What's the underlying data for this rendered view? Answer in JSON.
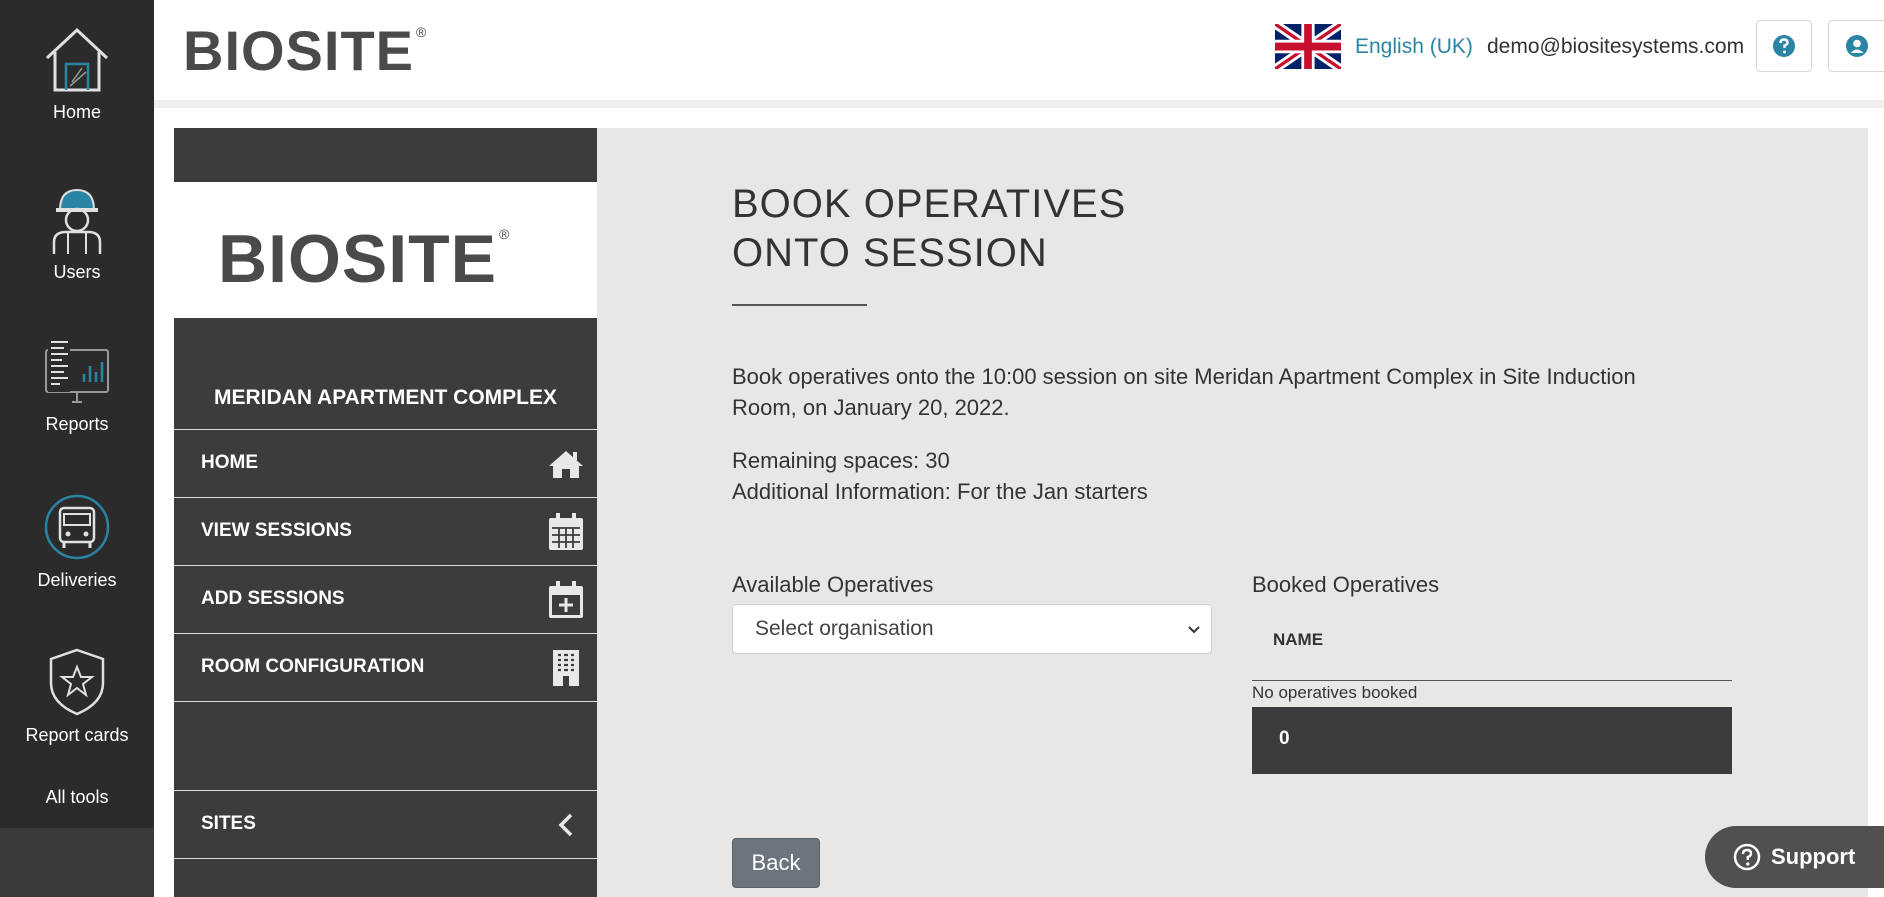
{
  "rail": {
    "items": [
      {
        "label": "Home",
        "icon": "house-icon"
      },
      {
        "label": "Users",
        "icon": "worker-icon"
      },
      {
        "label": "Reports",
        "icon": "reports-icon"
      },
      {
        "label": "Deliveries",
        "icon": "truck-icon"
      },
      {
        "label": "Report cards",
        "icon": "shield-star-icon"
      },
      {
        "label": "All tools"
      }
    ]
  },
  "header": {
    "brand": "BIOSITE",
    "brand_mark": "®",
    "language": "English (UK)",
    "email": "demo@biositesystems.com"
  },
  "site_nav": {
    "brand": "BIOSITE",
    "brand_mark": "®",
    "site_name": "MERIDAN APARTMENT COMPLEX",
    "items": [
      {
        "label": "HOME",
        "icon": "home-icon"
      },
      {
        "label": "VIEW SESSIONS",
        "icon": "calendar-icon"
      },
      {
        "label": "ADD SESSIONS",
        "icon": "calendar-add-icon"
      },
      {
        "label": "ROOM CONFIGURATION",
        "icon": "building-icon"
      }
    ],
    "sites_label": "SITES"
  },
  "main": {
    "title_line1": "BOOK OPERATIVES",
    "title_line2": "ONTO SESSION",
    "description": "Book operatives onto the 10:00 session on site Meridan Apartment Complex in Site Induction Room, on January 20, 2022.",
    "remaining_spaces": "Remaining spaces: 30",
    "additional_info": "Additional Information: For the Jan starters",
    "available_label": "Available Operatives",
    "select_value": "Select organisation",
    "booked_label": "Booked Operatives",
    "column_name": "NAME",
    "no_ops": "No operatives booked",
    "booked_count": "0",
    "back_label": "Back"
  },
  "support": {
    "label": "Support"
  },
  "colors": {
    "accent": "#2a85a5",
    "dark": "#3c3b3d",
    "rail": "#2b2b2b",
    "panel": "#e8e7e6"
  }
}
